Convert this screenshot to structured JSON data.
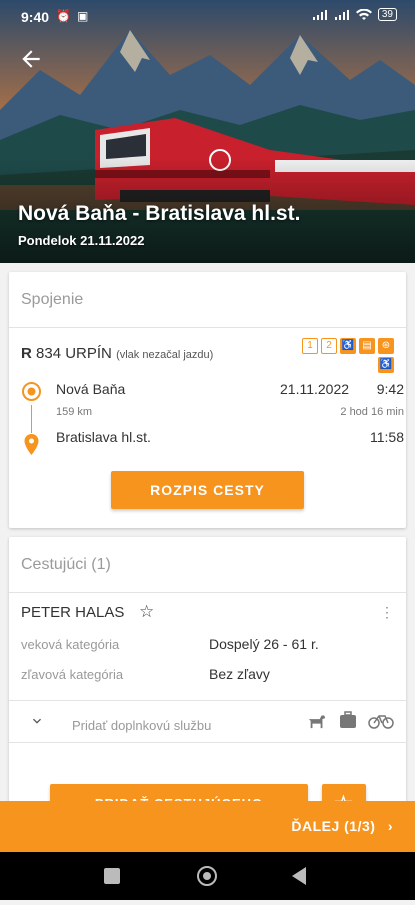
{
  "status": {
    "time": "9:40",
    "battery": "39"
  },
  "header": {
    "route": "Nová Baňa - Bratislava hl.st.",
    "date": "Pondelok 21.11.2022"
  },
  "connection": {
    "heading": "Spojenie",
    "train_type": "R",
    "train_number": "834",
    "train_name": "URPÍN",
    "train_note": "(vlak nezačal jazdu)",
    "feature_icons": [
      "1",
      "2",
      "kids-icon",
      "restaurant-icon",
      "bicycle-icon",
      "wheelchair-icon"
    ],
    "from": {
      "station": "Nová Baňa",
      "date": "21.11.2022",
      "time": "9:42"
    },
    "distance": "159 km",
    "duration": "2 hod 16 min",
    "to": {
      "station": "Bratislava hl.st.",
      "time": "11:58"
    },
    "button": "ROZPIS CESTY"
  },
  "passengers": {
    "heading": "Cestujúci (1)",
    "name": "PETER HALAS",
    "age_label": "veková kategória",
    "age_value": "Dospelý  26 - 61 r.",
    "discount_label": "zľavová kategória",
    "discount_value": "Bez zľavy",
    "service_label": "Pridať doplnkovú službu",
    "add_button": "PRIDAŤ CESTUJÚCEHO"
  },
  "footer": {
    "next": "ĎALEJ (1/3)"
  },
  "colors": {
    "accent": "#f7941d"
  }
}
